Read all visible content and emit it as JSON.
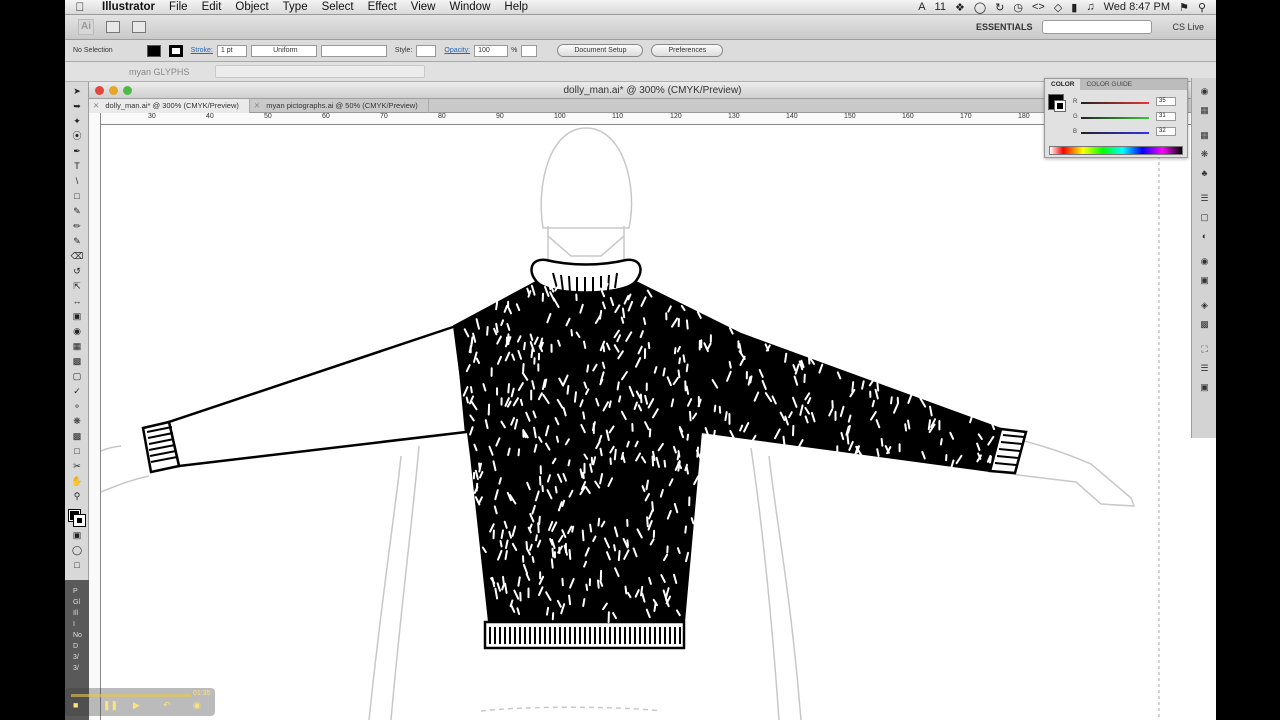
{
  "menubar": {
    "app_name": "Illustrator",
    "items": [
      "File",
      "Edit",
      "Object",
      "Type",
      "Select",
      "Effect",
      "View",
      "Window",
      "Help"
    ],
    "status_count": "11",
    "clock": "Wed 8:47 PM"
  },
  "appbar": {
    "logo": "Ai",
    "workspace": "ESSENTIALS",
    "cs_live": "CS Live"
  },
  "control": {
    "selection": "No Selection",
    "stroke_label": "Stroke:",
    "stroke_weight": "1 pt",
    "profile": "Uniform",
    "style_label": "Style:",
    "opacity_label": "Opacity:",
    "opacity_value": "100",
    "opacity_unit": "%",
    "document_setup": "Document Setup",
    "preferences": "Preferences"
  },
  "glyph_panel": {
    "name": "myan GLYPHS"
  },
  "document": {
    "title": "dolly_man.ai* @ 300% (CMYK/Preview)",
    "tabs": [
      {
        "label": "dolly_man.ai* @ 300% (CMYK/Preview)",
        "active": true
      },
      {
        "label": "myan pictographs.ai @ 50% (CMYK/Preview)",
        "active": false
      }
    ],
    "ruler_numbers": [
      "30",
      "40",
      "50",
      "60",
      "70",
      "80",
      "90",
      "100",
      "110",
      "120",
      "130",
      "140",
      "150",
      "160",
      "170",
      "180"
    ]
  },
  "color_panel": {
    "tab_color": "COLOR",
    "tab_guide": "COLOR GUIDE",
    "r_label": "R",
    "g_label": "G",
    "b_label": "B",
    "r_value": "35",
    "g_value": "31",
    "b_value": "32"
  },
  "left_panel": {
    "lines": [
      "P",
      "Gl",
      "Ill",
      "I",
      "No",
      "D",
      "3/",
      "3/"
    ]
  },
  "media": {
    "time": "01:35"
  },
  "colors": {
    "sweater": "#000000",
    "guide": "#c8c8c8",
    "canvas": "#ffffff"
  }
}
